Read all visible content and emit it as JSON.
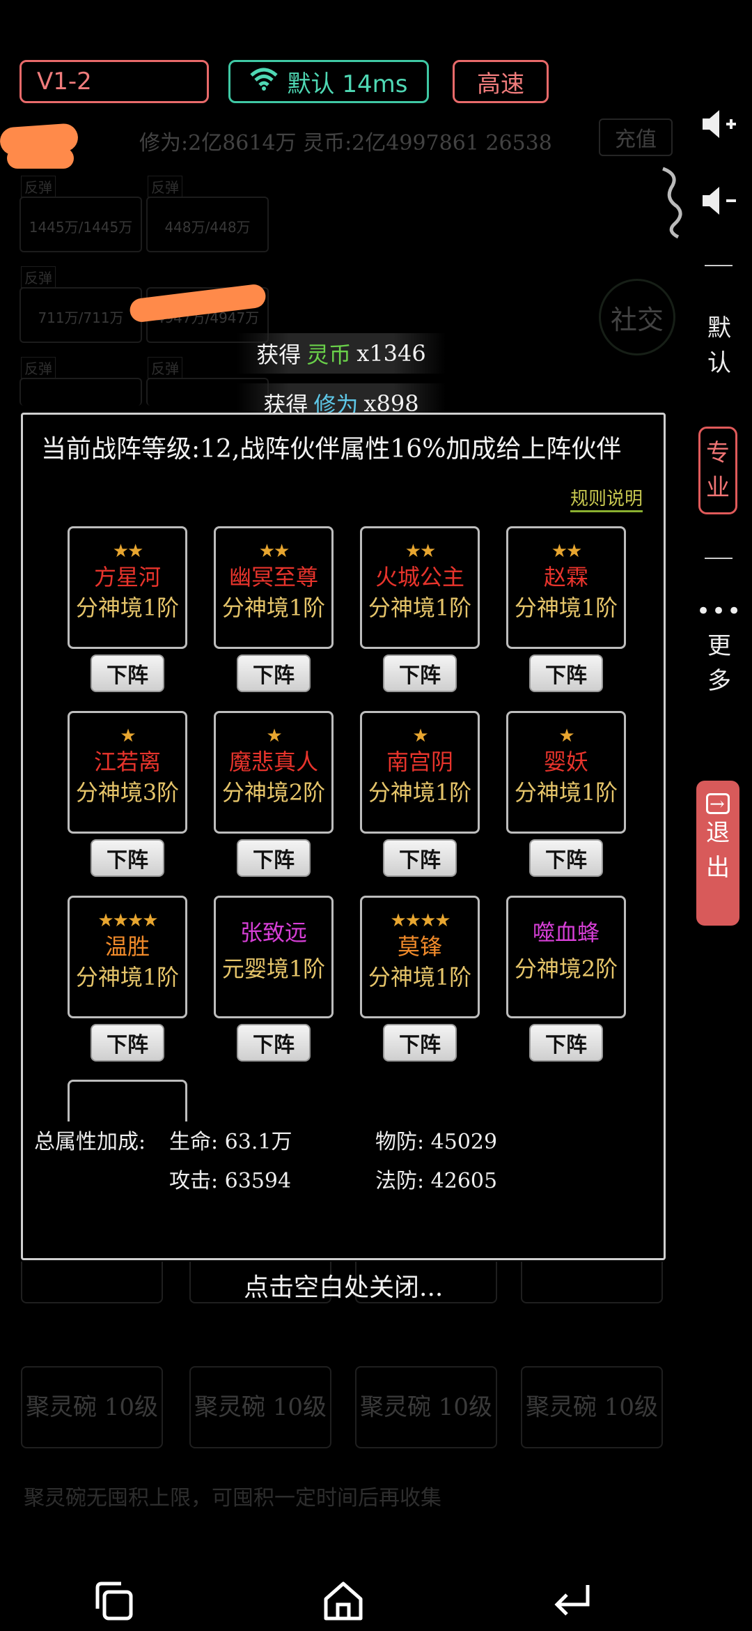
{
  "status_bar": {
    "version": "V1-2",
    "network": "默认 14ms",
    "speed": "高速"
  },
  "background": {
    "resources": "修为:2亿8614万  灵币:2亿4997861 26538",
    "recharge": "充值",
    "social": "社交",
    "card_values": [
      "1445万/1445万",
      "448万/448万",
      "711万/711万",
      "4947万/4947万"
    ],
    "tag": "反弹",
    "gather_label": "聚灵碗 10级",
    "gather_hint": "聚灵碗无囤积上限，可囤积一定时间后再收集"
  },
  "toasts": [
    {
      "prefix": "获得",
      "item": "灵币",
      "amount": "x1346",
      "color": "green"
    },
    {
      "prefix": "获得",
      "item": "修为",
      "amount": "x898",
      "color": "cyan"
    }
  ],
  "side_toolbar": {
    "volume_up": "◀+",
    "volume_down": "◀-",
    "default_label": "默认",
    "pro_label": "专业",
    "more_label": "更多",
    "exit_label": "退出"
  },
  "dialog": {
    "title": "当前战阵等级:12,战阵伙伴属性16%加成给上阵伙伴",
    "rules_link": "规则说明",
    "remove_label": "下阵",
    "partners": [
      {
        "stars": "★★",
        "name": "方星河",
        "realm": "分神境1阶",
        "name_color": "#e8342c"
      },
      {
        "stars": "★★",
        "name": "幽冥至尊",
        "realm": "分神境1阶",
        "name_color": "#e8342c"
      },
      {
        "stars": "★★",
        "name": "火城公主",
        "realm": "分神境1阶",
        "name_color": "#e8342c"
      },
      {
        "stars": "★★",
        "name": "赵霖",
        "realm": "分神境1阶",
        "name_color": "#e8342c"
      },
      {
        "stars": "★",
        "name": "江若离",
        "realm": "分神境3阶",
        "name_color": "#e8342c"
      },
      {
        "stars": "★",
        "name": "魔悲真人",
        "realm": "分神境2阶",
        "name_color": "#e8342c"
      },
      {
        "stars": "★",
        "name": "南宫阴",
        "realm": "分神境1阶",
        "name_color": "#e8342c"
      },
      {
        "stars": "★",
        "name": "婴妖",
        "realm": "分神境1阶",
        "name_color": "#e8342c"
      },
      {
        "stars": "★★★★",
        "name": "温胜",
        "realm": "分神境1阶",
        "name_color": "#f08a2a"
      },
      {
        "stars": "",
        "name": "张致远",
        "realm": "元婴境1阶",
        "name_color": "#d63fd6"
      },
      {
        "stars": "★★★★",
        "name": "莫锋",
        "realm": "分神境1阶",
        "name_color": "#f08a2a"
      },
      {
        "stars": "",
        "name": "噬血蜂",
        "realm": "分神境2阶",
        "name_color": "#d63fd6"
      }
    ],
    "totals": {
      "label": "总属性加成:",
      "hp": "生命: 63.1万",
      "pdef": "物防: 45029",
      "atk": "攻击: 63594",
      "mdef": "法防: 42605"
    }
  },
  "close_hint": "点击空白处关闭...",
  "nav": {
    "recents": "recents-icon",
    "home": "home-icon",
    "back": "back-icon"
  }
}
